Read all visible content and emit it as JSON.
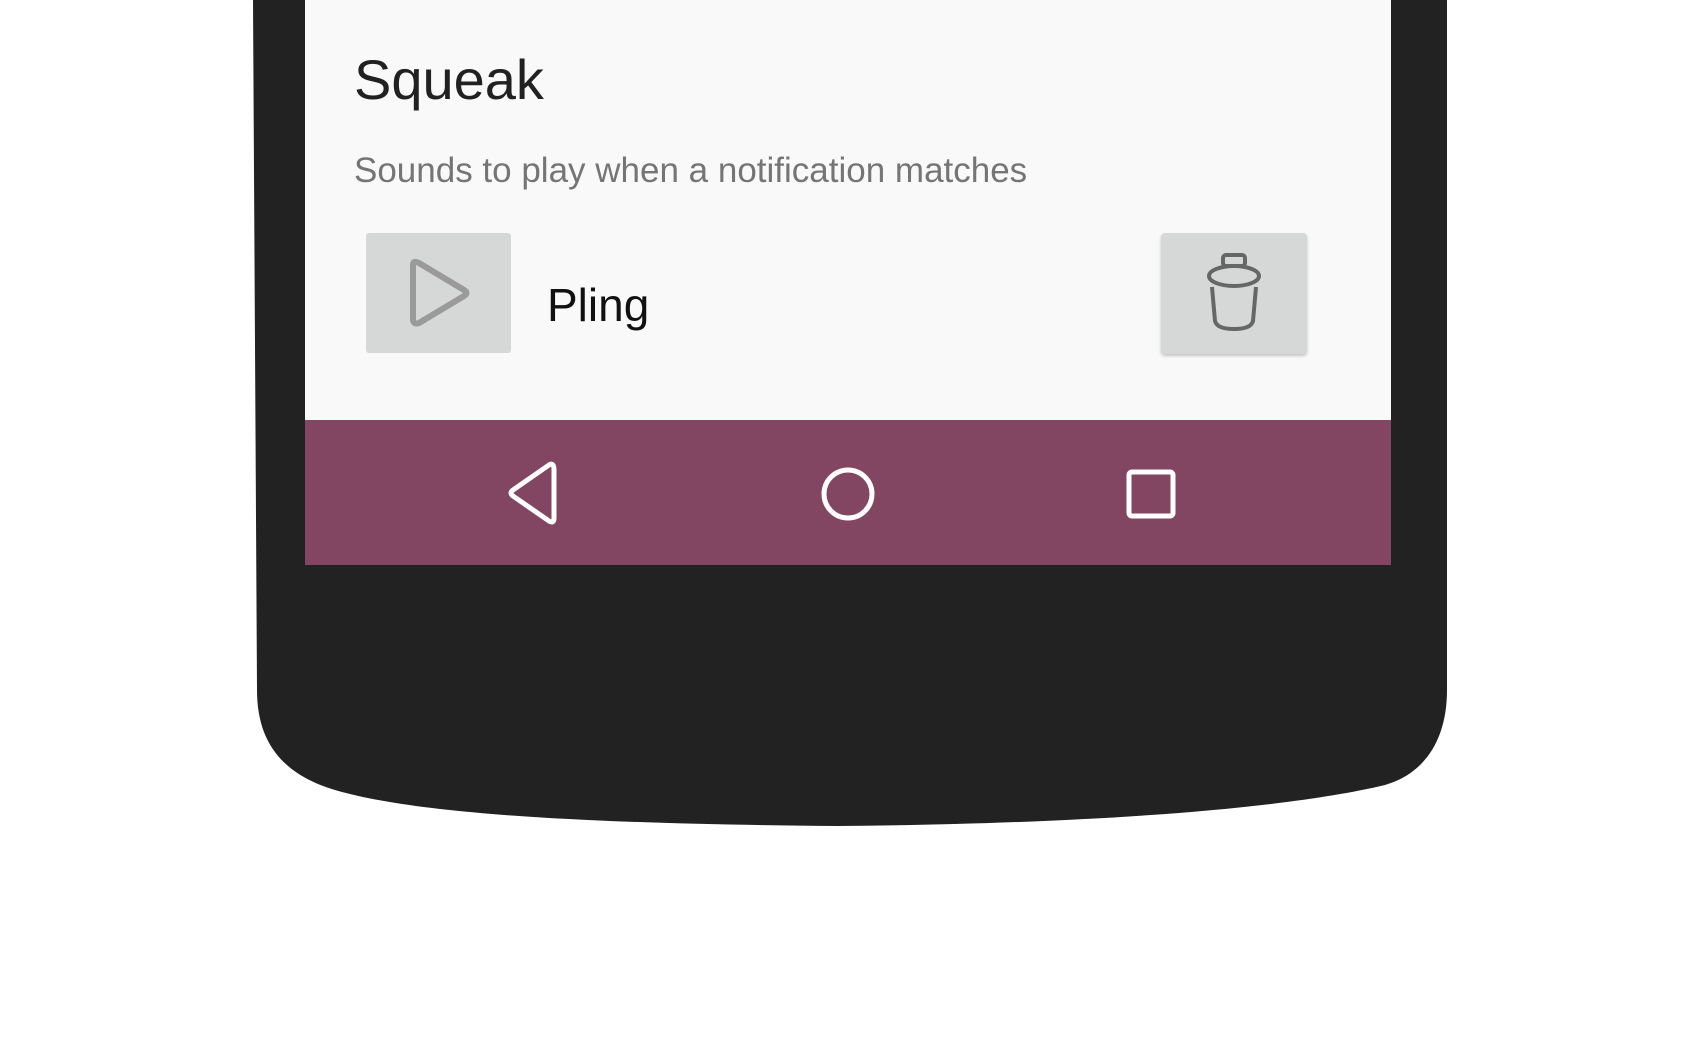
{
  "app": {
    "title": "Squeak",
    "subtitle": "Sounds to play when a notification matches"
  },
  "sounds": [
    {
      "name": "Pling",
      "play_icon": "play-icon",
      "delete_icon": "trash-icon"
    }
  ],
  "navigation": {
    "back_icon": "back-triangle-icon",
    "home_icon": "home-circle-icon",
    "recents_icon": "recents-square-icon"
  },
  "colors": {
    "screen_background": "#f9f9f9",
    "nav_bar": "#824663",
    "device_frame": "#222222",
    "button_background": "#d6d7d7",
    "title_text": "#212121",
    "subtitle_text": "#757575"
  }
}
